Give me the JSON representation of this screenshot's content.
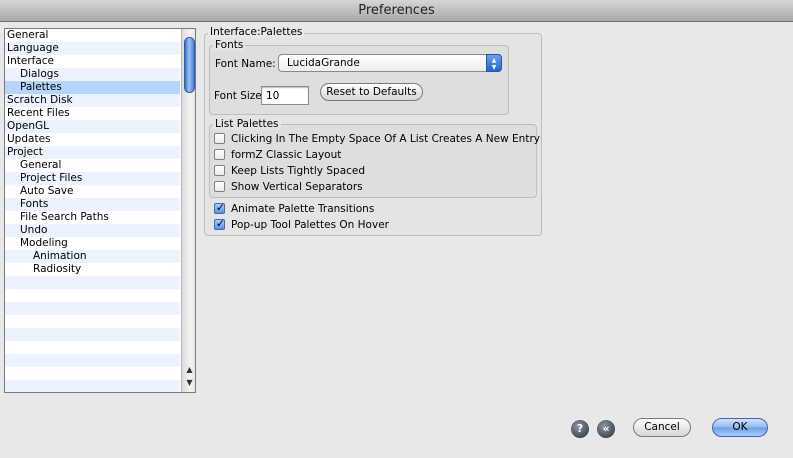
{
  "window": {
    "title": "Preferences"
  },
  "sidebar": {
    "items": [
      {
        "label": "General",
        "level": 0
      },
      {
        "label": "Language",
        "level": 0
      },
      {
        "label": "Interface",
        "level": 0
      },
      {
        "label": "Dialogs",
        "level": 1
      },
      {
        "label": "Palettes",
        "level": 1,
        "selected": true
      },
      {
        "label": "Scratch Disk",
        "level": 0
      },
      {
        "label": "Recent Files",
        "level": 0
      },
      {
        "label": "OpenGL",
        "level": 0
      },
      {
        "label": "Updates",
        "level": 0
      },
      {
        "label": "Project",
        "level": 0
      },
      {
        "label": "General",
        "level": 1
      },
      {
        "label": "Project Files",
        "level": 1
      },
      {
        "label": "Auto Save",
        "level": 1
      },
      {
        "label": "Fonts",
        "level": 1
      },
      {
        "label": "File Search Paths",
        "level": 1
      },
      {
        "label": "Undo",
        "level": 1
      },
      {
        "label": "Modeling",
        "level": 1
      },
      {
        "label": "Animation",
        "level": 2
      },
      {
        "label": "Radiosity",
        "level": 2
      }
    ],
    "scroll_up_glyph": "▲",
    "scroll_down_glyph": "▼"
  },
  "panel": {
    "title": "Interface:Palettes",
    "fonts_group": {
      "title": "Fonts",
      "font_name_label": "Font Name:",
      "font_name_value": "LucidaGrande",
      "font_size_label": "Font Size",
      "font_size_value": "10",
      "reset_button": "Reset to Defaults"
    },
    "list_palettes_group": {
      "title": "List Palettes",
      "options": [
        {
          "label": "Clicking In The Empty Space Of A List Creates A New Entry",
          "checked": false
        },
        {
          "label": "formZ Classic Layout",
          "checked": false
        },
        {
          "label": "Keep Lists Tightly Spaced",
          "checked": false
        },
        {
          "label": "Show Vertical Separators",
          "checked": false
        }
      ]
    },
    "extra_options": [
      {
        "label": "Animate Palette Transitions",
        "checked": true
      },
      {
        "label": "Pop-up Tool Palettes On Hover",
        "checked": true
      }
    ]
  },
  "footer": {
    "help_icon_glyph": "?",
    "back_icon_glyph": "«",
    "cancel_button": "Cancel",
    "ok_button": "OK"
  },
  "icons": {
    "help": "help-icon",
    "back": "rewind-icon",
    "select_arrows": "updown-arrows-icon",
    "checkmark": "checkmark-icon"
  },
  "colors": {
    "selection": "#b5d5ff",
    "stripe": "#edf3fe",
    "accent": "#2561d4"
  }
}
